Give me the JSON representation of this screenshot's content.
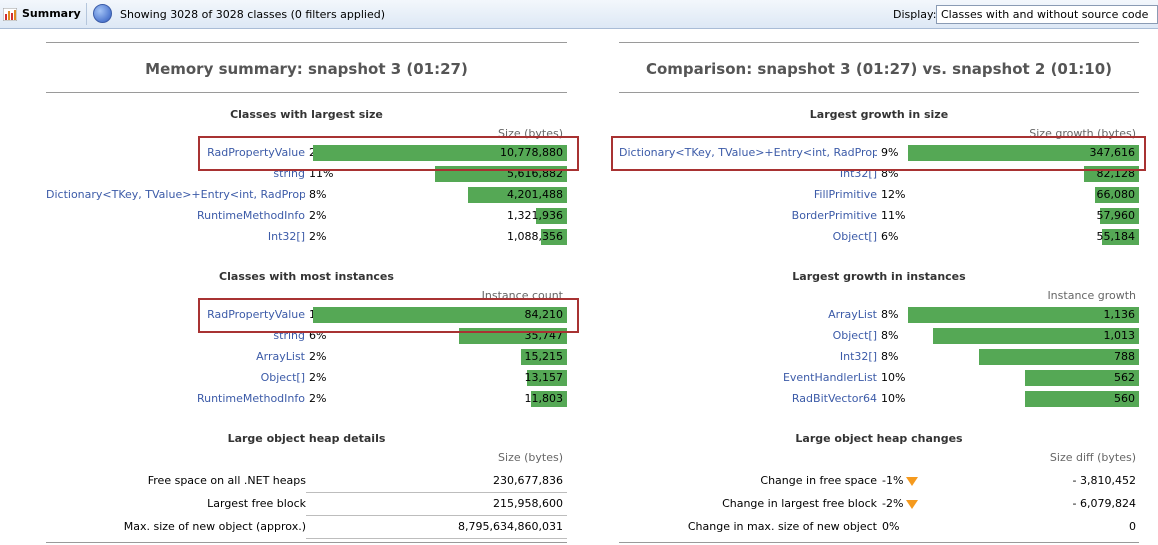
{
  "toolbar": {
    "title": "Summary",
    "status": "Showing 3028 of 3028 classes (0 filters applied)",
    "display_label": "Display:",
    "display_value": "Classes with and without source code",
    "icon": "bar-chart-icon",
    "status_icon": "filter-circle-icon"
  },
  "left": {
    "title": "Memory summary: snapshot 3 (01:27)",
    "largest": {
      "title": "Classes with largest size",
      "col": "Size (bytes)",
      "rows": [
        {
          "name": "RadPropertyValue",
          "pct": "22%",
          "value": "10,778,880",
          "fraction": 1.0
        },
        {
          "name": "string",
          "pct": "11%",
          "value": "5,616,882",
          "fraction": 0.521
        },
        {
          "name": "Dictionary<TKey, TValue>+Entry<int, RadProp...",
          "pct": "8%",
          "value": "4,201,488",
          "fraction": 0.39
        },
        {
          "name": "RuntimeMethodInfo",
          "pct": "2%",
          "value": "1,321,936",
          "fraction": 0.123
        },
        {
          "name": "Int32[]",
          "pct": "2%",
          "value": "1,088,356",
          "fraction": 0.101
        }
      ]
    },
    "instances": {
      "title": "Classes with most instances",
      "col": "Instance count",
      "rows": [
        {
          "name": "RadPropertyValue",
          "pct": "15%",
          "value": "84,210",
          "fraction": 1.0
        },
        {
          "name": "string",
          "pct": "6%",
          "value": "35,747",
          "fraction": 0.425
        },
        {
          "name": "ArrayList",
          "pct": "2%",
          "value": "15,215",
          "fraction": 0.181
        },
        {
          "name": "Object[]",
          "pct": "2%",
          "value": "13,157",
          "fraction": 0.156
        },
        {
          "name": "RuntimeMethodInfo",
          "pct": "2%",
          "value": "11,803",
          "fraction": 0.14
        }
      ]
    },
    "loh": {
      "title": "Large object heap details",
      "col": "Size (bytes)",
      "rows": [
        {
          "label": "Free space on all .NET heaps",
          "value": "230,677,836"
        },
        {
          "label": "Largest free block",
          "value": "215,958,600"
        },
        {
          "label": "Max. size of new object (approx.)",
          "value": "8,795,634,860,031"
        }
      ]
    }
  },
  "right": {
    "title": "Comparison: snapshot 3 (01:27) vs. snapshot 2 (01:10)",
    "growth_size": {
      "title": "Largest growth in size",
      "col": "Size growth (bytes)",
      "rows": [
        {
          "name": "Dictionary<TKey, TValue>+Entry<int, RadProp...",
          "pct": "9%",
          "value": "347,616",
          "fraction": 1.0
        },
        {
          "name": "Int32[]",
          "pct": "8%",
          "value": "82,128",
          "fraction": 0.236
        },
        {
          "name": "FillPrimitive",
          "pct": "12%",
          "value": "66,080",
          "fraction": 0.19
        },
        {
          "name": "BorderPrimitive",
          "pct": "11%",
          "value": "57,960",
          "fraction": 0.167
        },
        {
          "name": "Object[]",
          "pct": "6%",
          "value": "55,184",
          "fraction": 0.159
        }
      ]
    },
    "growth_instances": {
      "title": "Largest growth in instances",
      "col": "Instance growth",
      "rows": [
        {
          "name": "ArrayList",
          "pct": "8%",
          "value": "1,136",
          "fraction": 1.0
        },
        {
          "name": "Object[]",
          "pct": "8%",
          "value": "1,013",
          "fraction": 0.892
        },
        {
          "name": "Int32[]",
          "pct": "8%",
          "value": "788",
          "fraction": 0.694
        },
        {
          "name": "EventHandlerList",
          "pct": "10%",
          "value": "562",
          "fraction": 0.495
        },
        {
          "name": "RadBitVector64",
          "pct": "10%",
          "value": "560",
          "fraction": 0.493
        }
      ]
    },
    "loh": {
      "title": "Large object heap changes",
      "col": "Size diff (bytes)",
      "rows": [
        {
          "label": "Change in free space",
          "pct": "-1%",
          "value": "- 3,810,452",
          "arrow": true
        },
        {
          "label": "Change in largest free block",
          "pct": "-2%",
          "value": "- 6,079,824",
          "arrow": true
        },
        {
          "label": "Change in max. size of new object",
          "pct": "0%",
          "value": "0",
          "arrow": false
        }
      ]
    }
  }
}
